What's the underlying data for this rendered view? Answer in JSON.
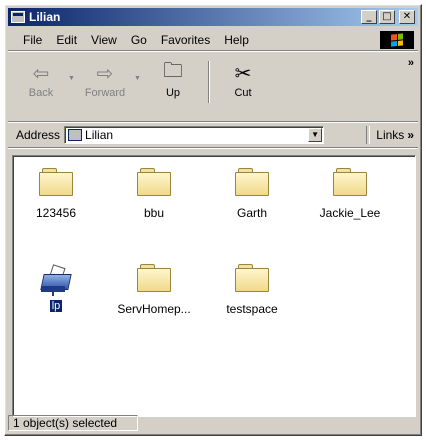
{
  "window": {
    "title": "Lilian",
    "controls": {
      "minimize": "_",
      "maximize": "□",
      "close": "✕"
    }
  },
  "menu": {
    "items": [
      "File",
      "Edit",
      "View",
      "Go",
      "Favorites",
      "Help"
    ]
  },
  "toolbar": {
    "back_label": "Back",
    "forward_label": "Forward",
    "up_label": "Up",
    "cut_label": "Cut",
    "overflow": "»"
  },
  "address": {
    "label": "Address",
    "value": "Lilian",
    "links_label": "Links",
    "links_overflow": "»"
  },
  "files": [
    {
      "name": "123456",
      "type": "folder"
    },
    {
      "name": "bbu",
      "type": "folder"
    },
    {
      "name": "Garth",
      "type": "folder"
    },
    {
      "name": "Jackie_Lee",
      "type": "folder"
    },
    {
      "name": "lp",
      "type": "printer",
      "selected": true
    },
    {
      "name": "ServHomep...",
      "type": "folder"
    },
    {
      "name": "testspace",
      "type": "folder"
    }
  ],
  "status": {
    "text": "1 object(s) selected"
  },
  "colors": {
    "titlebar_start": "#0a246a",
    "titlebar_end": "#a6caf0",
    "selection": "#0a246a",
    "chrome": "#d4d0c8"
  }
}
